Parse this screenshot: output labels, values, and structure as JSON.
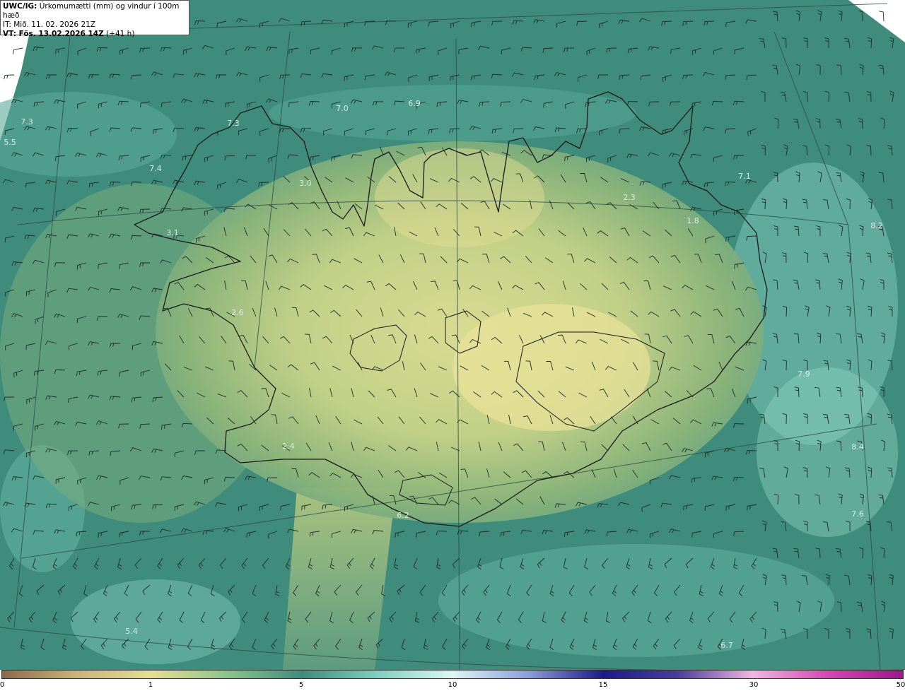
{
  "header": {
    "line1_prefix": "UWC/IG:",
    "line1_text": " Úrkomumætti (mm) og vindur í 100m hæð",
    "line2": "IT: Mið. 11. 02. 2026 21Z",
    "line3_prefix": "VT: Fös. 13.02.2026 14Z",
    "line3_suffix": " (+41 h)"
  },
  "map": {
    "colors": {
      "land_high": "#d8dc8c",
      "land_mid": "#8fb479",
      "sea": "#3f8c7c",
      "sea_light": "#7cc4b6",
      "coast": "#1a1a1a"
    },
    "value_labels": [
      {
        "text": "7.3"
      },
      {
        "text": "5.5"
      },
      {
        "text": "7.4"
      },
      {
        "text": "7.3"
      },
      {
        "text": "7.0"
      },
      {
        "text": "6.9"
      },
      {
        "text": "3.0"
      },
      {
        "text": "3.1"
      },
      {
        "text": "2.6"
      },
      {
        "text": "2.4"
      },
      {
        "text": "6.2"
      },
      {
        "text": "5.4"
      },
      {
        "text": "7.1"
      },
      {
        "text": "8.2"
      },
      {
        "text": "7.9"
      },
      {
        "text": "8.4"
      },
      {
        "text": "7.6"
      },
      {
        "text": "6.7"
      },
      {
        "text": "2.3"
      },
      {
        "text": "1.8"
      }
    ]
  },
  "colorbar": {
    "ticks": [
      {
        "label": "0"
      },
      {
        "label": "1"
      },
      {
        "label": "5"
      },
      {
        "label": "10"
      },
      {
        "label": "15"
      },
      {
        "label": "30"
      },
      {
        "label": "50"
      }
    ]
  }
}
